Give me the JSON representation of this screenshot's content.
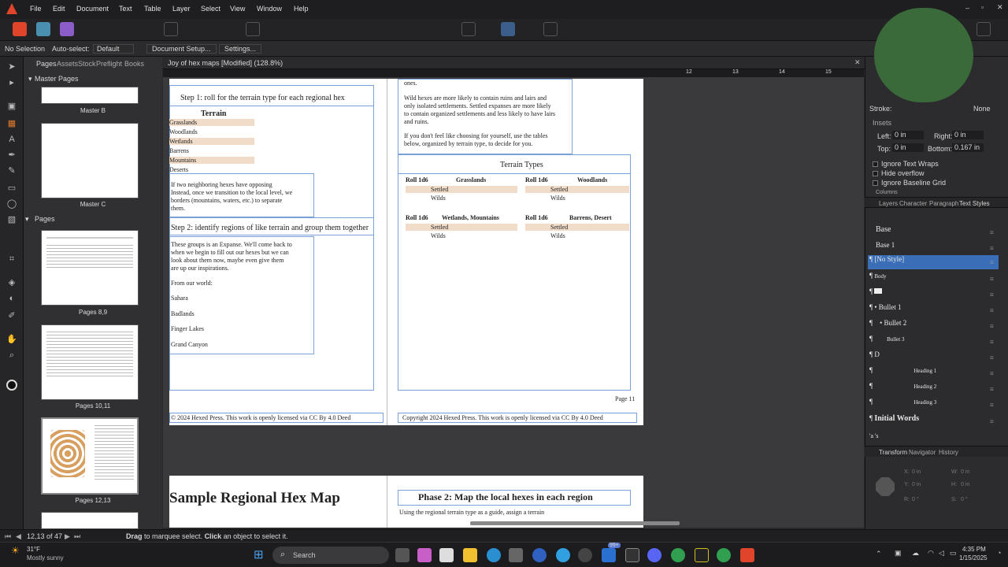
{
  "menu": [
    "File",
    "Edit",
    "Document",
    "Text",
    "Table",
    "Layer",
    "Select",
    "View",
    "Window",
    "Help"
  ],
  "context": {
    "selection": "No Selection",
    "autoselect_label": "Auto-select:",
    "autoselect_value": "Default",
    "document_setup": "Document Setup...",
    "settings": "Settings..."
  },
  "panel_tabs": [
    "Pages",
    "Assets",
    "Stock",
    "Preflight",
    "Books"
  ],
  "doc_tab": "Joy of hex maps [Modified] (128.8%)",
  "master_pages_header": "Master Pages",
  "pages_header": "Pages",
  "thumbs": [
    {
      "label": "Master B"
    },
    {
      "label": "Master C"
    },
    {
      "label": "Pages 8,9"
    },
    {
      "label": "Pages 10,11"
    },
    {
      "label": "Pages 12,13"
    }
  ],
  "ruler_numbers": [
    "12",
    "13",
    "14",
    "15"
  ],
  "left_page": {
    "step1": "Step 1: roll for the terrain type for each regional hex",
    "terrain_header": "Terrain",
    "terrain_rows": [
      "Grasslands",
      "Woodlands",
      "Wetlands",
      "Barrens",
      "Mountains",
      "Deserts"
    ],
    "neighbor_text": [
      "If two neighboring hexes have opposing",
      "Instead, once we transition to the local level, we",
      "borders (mountains, waters, etc.) to separate",
      "them."
    ],
    "step2": "Step 2: identify regions of like terrain and group them together",
    "expanse_lines": [
      "These groups is an Expanse. We'll come back to",
      "when we begin to fill out our hexes but we can",
      "look about them now, maybe even give them",
      "are up our inspirations."
    ],
    "world_items": [
      "From our world:",
      "Sahara",
      "Badlands",
      "Finger Lakes",
      "Grand Canyon"
    ],
    "footer": "© 2024 Hexed Press. This work is openly licensed via CC By 4.0 Deed"
  },
  "right_page": {
    "intro_lines": [
      "ones.",
      "Wild hexes are more likely to contain ruins and lairs and",
      "only isolated settlements. Settled expanses are more likely",
      "to contain organized settlements and less likely to have lairs",
      "and ruins."
    ],
    "choose_lines": [
      "If you don't feel like choosing for yourself, use the tables",
      "below, organized by terrain type, to decide for you."
    ],
    "table_title": "Terrain Types",
    "roll_header": "Roll 1d6",
    "groups": [
      "Grasslands",
      "Woodlands",
      "Wetlands, Mountains",
      "Barrens, Desert"
    ],
    "settled": "Settled",
    "wilds": "Wilds",
    "page_num": "Page 11",
    "footer": "Copyright 2024 Hexed Press. This work is openly licensed via CC By 4.0 Deed"
  },
  "lower_spread": {
    "left_title": "Sample Regional Hex Map",
    "right_title": "Phase 2: Map the local hexes in each region",
    "right_intro": "Using the regional terrain type as a guide, assign a terrain"
  },
  "right_panel": {
    "stroke_label": "Stroke:",
    "stroke_value": "None",
    "insets_label": "Insets",
    "left_label": "Left:",
    "left_value": "0 in",
    "right_label": "Right:",
    "right_value": "0 in",
    "top_label": "Top:",
    "top_value": "0 in",
    "bottom_label": "Bottom:",
    "bottom_value": "0.167 in",
    "checks": [
      "Ignore Text Wraps",
      "Hide overflow",
      "Ignore Baseline Grid"
    ],
    "columns_label": "Columns",
    "tabs": [
      "Layers",
      "Character",
      "Paragraph",
      "Text Styles"
    ],
    "styles": [
      "Base",
      "Base 1",
      "[No Style]",
      "Body",
      "",
      "Bullet 1",
      "Bullet 2",
      "Bullet 3",
      "D",
      "Heading 1",
      "Heading 2",
      "Heading 3",
      "Initial Words",
      "'a 's"
    ],
    "bottom_tabs": [
      "Transform",
      "Navigator",
      "History"
    ],
    "transform": {
      "x": "X:",
      "x_val": "0 in",
      "w": "W:",
      "w_val": "0 in",
      "y": "Y:",
      "y_val": "0 in",
      "h": "H:",
      "h_val": "0 in",
      "r": "R:",
      "r_val": "0 °",
      "s": "S:",
      "s_val": "0 °"
    }
  },
  "status": {
    "pages": "12,13 of 47",
    "hint_drag": "Drag",
    "hint_mid": " to marquee select. ",
    "hint_click": "Click",
    "hint_end": " an object to select it."
  },
  "taskbar": {
    "temp": "31°F",
    "weather": "Mostly sunny",
    "search": "Search",
    "time": "4:35 PM",
    "date": "1/15/2025",
    "badge": "99+"
  },
  "colors": {
    "accent": "#4a78c8",
    "selected_style": "#3a6fb8",
    "highlight": "#f0dcc8"
  }
}
